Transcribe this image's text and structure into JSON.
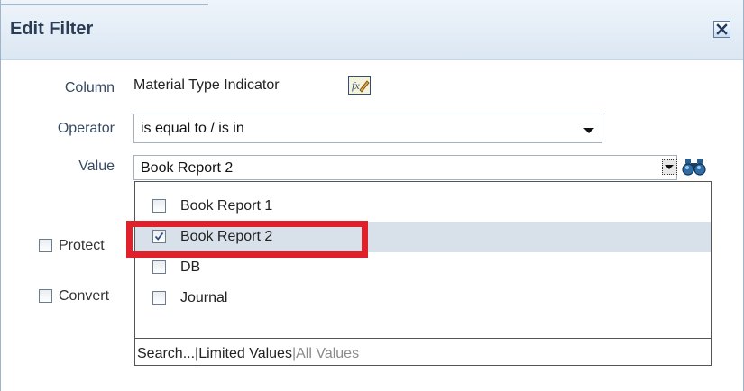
{
  "dialog": {
    "title": "Edit Filter",
    "close_icon": "close-icon"
  },
  "form": {
    "column_label": "Column",
    "column_value": "Material Type Indicator",
    "column_icon": "formula-edit-icon",
    "operator_label": "Operator",
    "operator_value": "is equal to / is in",
    "value_label": "Value",
    "value_value": "Book Report 2",
    "value_search_icon": "binoculars-icon"
  },
  "background_options": [
    {
      "label": "Protect",
      "checked": false
    },
    {
      "label": "Convert",
      "checked": false
    }
  ],
  "dropdown": {
    "items": [
      {
        "label": "Book Report 1",
        "checked": false
      },
      {
        "label": "Book Report 2",
        "checked": true
      },
      {
        "label": "DB",
        "checked": false
      },
      {
        "label": "Journal",
        "checked": false
      }
    ],
    "footer": {
      "search": "Search...",
      "limited": "Limited Values",
      "all": "All Values",
      "separator": "|"
    }
  },
  "colors": {
    "title_bg": "#dbe7f3",
    "selected_row": "#d8e1ea",
    "highlight": "#e0202a"
  }
}
